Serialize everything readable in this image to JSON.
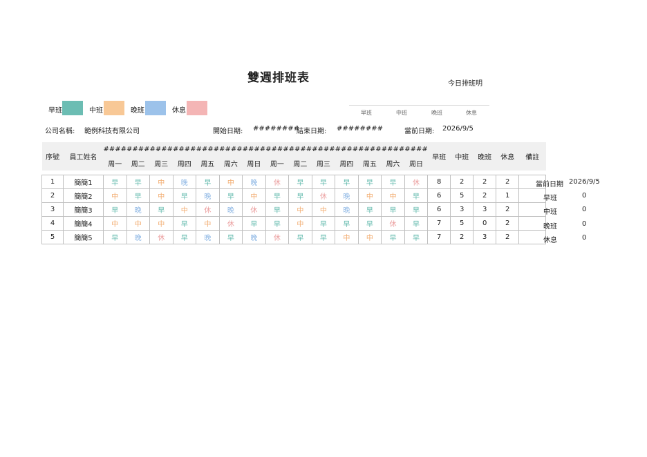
{
  "title": "雙週排班表",
  "today_label": "今日排班明",
  "legend": [
    {
      "label": "早班",
      "color": "#6cbdb3"
    },
    {
      "label": "中班",
      "color": "#f8c896"
    },
    {
      "label": "晚班",
      "color": "#9cc2ea"
    },
    {
      "label": "休息",
      "color": "#f4b5b5"
    }
  ],
  "today_chart_labels": [
    "早班",
    "中班",
    "晚班",
    "休息"
  ],
  "info": {
    "company_label": "公司名稱:",
    "company_value": "範例科技有限公司",
    "start_label": "開始日期:",
    "start_value": "########",
    "end_label": "結束日期:",
    "end_value": "########",
    "current_label": "當前日期:",
    "current_value": "2026/9/5"
  },
  "table": {
    "header_index": "序號",
    "header_name": "員工姓名",
    "date_placeholder": "####",
    "weekdays": [
      "周一",
      "周二",
      "周三",
      "周四",
      "周五",
      "周六",
      "周日",
      "周一",
      "周二",
      "周三",
      "周四",
      "周五",
      "周六",
      "周日"
    ],
    "header_early": "早班",
    "header_mid": "中班",
    "header_late": "晚班",
    "header_off": "休息",
    "header_note": "備註",
    "rows": [
      {
        "index": "1",
        "name": "簡簡1",
        "shifts": [
          "早",
          "早",
          "中",
          "晚",
          "早",
          "中",
          "晚",
          "休",
          "早",
          "早",
          "早",
          "早",
          "早",
          "休"
        ],
        "early": "8",
        "mid": "2",
        "late": "2",
        "off": "2",
        "note": ""
      },
      {
        "index": "2",
        "name": "簡簡2",
        "shifts": [
          "中",
          "早",
          "中",
          "早",
          "晚",
          "早",
          "中",
          "早",
          "早",
          "休",
          "晚",
          "中",
          "中",
          "早"
        ],
        "early": "6",
        "mid": "5",
        "late": "2",
        "off": "1",
        "note": ""
      },
      {
        "index": "3",
        "name": "簡簡3",
        "shifts": [
          "早",
          "晚",
          "早",
          "中",
          "休",
          "晚",
          "休",
          "早",
          "中",
          "中",
          "晚",
          "早",
          "早",
          "早"
        ],
        "early": "6",
        "mid": "3",
        "late": "3",
        "off": "2",
        "note": ""
      },
      {
        "index": "4",
        "name": "簡簡4",
        "shifts": [
          "中",
          "中",
          "中",
          "早",
          "中",
          "休",
          "早",
          "早",
          "中",
          "早",
          "早",
          "早",
          "休",
          "早"
        ],
        "early": "7",
        "mid": "5",
        "late": "0",
        "off": "2",
        "note": ""
      },
      {
        "index": "5",
        "name": "簡簡5",
        "shifts": [
          "早",
          "晚",
          "休",
          "早",
          "晚",
          "早",
          "晚",
          "休",
          "早",
          "早",
          "中",
          "中",
          "早",
          "早"
        ],
        "early": "7",
        "mid": "2",
        "late": "3",
        "off": "2",
        "note": ""
      }
    ]
  },
  "side_summary": {
    "date_label": "當前日期",
    "date_value": "2026/9/5",
    "items": [
      {
        "label": "早班",
        "value": "0"
      },
      {
        "label": "中班",
        "value": "0"
      },
      {
        "label": "晚班",
        "value": "0"
      },
      {
        "label": "休息",
        "value": "0"
      }
    ]
  }
}
